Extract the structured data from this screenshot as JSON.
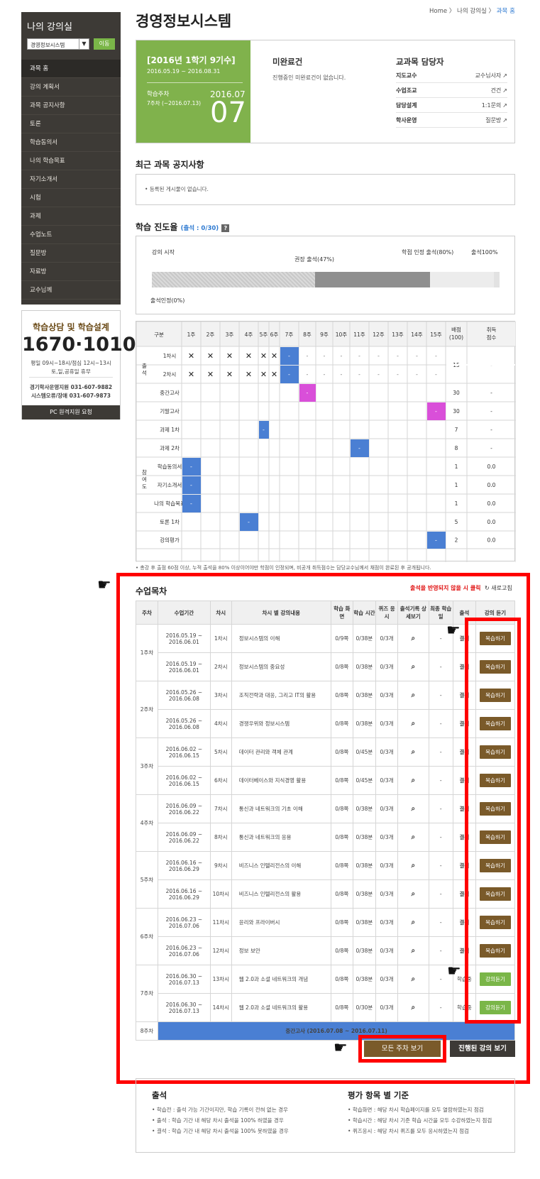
{
  "sidebar": {
    "title": "나의 강의실",
    "course_select": "경영정보시스템",
    "go_label": "이동",
    "menu": [
      "과목 홈",
      "강의 계획서",
      "과목 공지사항",
      "토론",
      "학습동의서",
      "나의 학습목표",
      "자기소개서",
      "시험",
      "과제",
      "수업노트",
      "질문방",
      "자료방",
      "교수님께"
    ],
    "help": {
      "title": "학습상담 및 학습설계",
      "phone": "1670·1010",
      "hours1": "평일 09시~18시/점심 12시~13시",
      "hours2": "토,일,공휴일 휴무",
      "contact1": "경기학사운영지원 031-607-9882",
      "contact2": "시스템오류/장애 031-607-9873",
      "remote": "PC 원격지원 요청"
    }
  },
  "header": {
    "title": "경영정보시스템",
    "breadcrumb": [
      "Home",
      "나의 강의실",
      "과목 홈"
    ]
  },
  "term": {
    "label": "[2016년 1학기 9기수]",
    "dates": "2016.05.19 ~ 2016.08.31",
    "week_label": "학습주차",
    "week_sub": "7주차 (~2016.07.13)",
    "month": "2016.07",
    "day": "07"
  },
  "unfinished": {
    "title": "미완료건",
    "text": "진행중인 미완료건이 없습니다."
  },
  "staff": {
    "title": "교과목 담당자",
    "rows": [
      {
        "k": "지도교수",
        "v": "교수님사자"
      },
      {
        "k": "수업조교",
        "v": "건건"
      },
      {
        "k": "담당설계",
        "v": "1:1문의"
      },
      {
        "k": "학사운영",
        "v": "질문방"
      }
    ]
  },
  "notice": {
    "title": "최근 과목 공지사항",
    "empty": "등록된 게시물이 없습니다."
  },
  "progress": {
    "title": "학습 진도율",
    "count": "(출석 : 0/30)",
    "help": "?",
    "labels": {
      "start": "강의 시작",
      "recommended": "권장 출석(47%)",
      "credit": "학점 인정 출석(80%)",
      "full": "출석100%",
      "current": "출석인정(0%)"
    },
    "values": {
      "current": 0,
      "recommended": 0.47,
      "credit": 0.8,
      "full": 1.0
    }
  },
  "attendance": {
    "headers": [
      "구분",
      "1주",
      "2주",
      "3주",
      "4주",
      "5주",
      "6주",
      "7주",
      "8주",
      "9주",
      "10주",
      "11주",
      "12주",
      "13주",
      "14주",
      "15주",
      "배점 (100)",
      "취득 점수"
    ],
    "group_att": "출석",
    "group_part": "참여도",
    "rows": [
      {
        "label": "1차시",
        "cells": [
          "x",
          "x",
          "x",
          "x",
          "x",
          "x",
          "b",
          "-",
          "-",
          "-",
          "-",
          "-",
          "-",
          "-",
          "-"
        ],
        "score": "15",
        "got": "-"
      },
      {
        "label": "2차시",
        "cells": [
          "x",
          "x",
          "x",
          "x",
          "x",
          "x",
          "b",
          "-",
          "-",
          "-",
          "-",
          "-",
          "-",
          "-",
          "-"
        ],
        "score": "",
        "got": ""
      },
      {
        "label": "중간고사",
        "cells": [
          "",
          "",
          "",
          "",
          "",
          "",
          "",
          "p",
          "",
          "",
          "",
          "",
          "",
          "",
          ""
        ],
        "score": "30",
        "got": "-"
      },
      {
        "label": "기말고사",
        "cells": [
          "",
          "",
          "",
          "",
          "",
          "",
          "",
          "",
          "",
          "",
          "",
          "",
          "",
          "",
          "p"
        ],
        "score": "30",
        "got": "-"
      },
      {
        "label": "과제 1차",
        "cells": [
          "",
          "",
          "",
          "",
          "b",
          "",
          "",
          "",
          "",
          "",
          "",
          "",
          "",
          "",
          ""
        ],
        "score": "7",
        "got": "-"
      },
      {
        "label": "과제 2차",
        "cells": [
          "",
          "",
          "",
          "",
          "",
          "",
          "",
          "",
          "",
          "",
          "b",
          "",
          "",
          "",
          ""
        ],
        "score": "8",
        "got": "-"
      },
      {
        "label": "학습동의서",
        "cells": [
          "b",
          "",
          "",
          "",
          "",
          "",
          "",
          "",
          "",
          "",
          "",
          "",
          "",
          "",
          ""
        ],
        "score": "1",
        "got": "0.0"
      },
      {
        "label": "자기소개서",
        "cells": [
          "b",
          "",
          "",
          "",
          "",
          "",
          "",
          "",
          "",
          "",
          "",
          "",
          "",
          "",
          ""
        ],
        "score": "1",
        "got": "0.0"
      },
      {
        "label": "나의 학습목표",
        "cells": [
          "b",
          "",
          "",
          "",
          "",
          "",
          "",
          "",
          "",
          "",
          "",
          "",
          "",
          "",
          ""
        ],
        "score": "1",
        "got": "0.0"
      },
      {
        "label": "토론 1차",
        "cells": [
          "",
          "",
          "",
          "b",
          "",
          "",
          "",
          "",
          "",
          "",
          "",
          "",
          "",
          "",
          ""
        ],
        "score": "5",
        "got": "0.0"
      },
      {
        "label": "강의평가",
        "cells": [
          "",
          "",
          "",
          "",
          "",
          "",
          "",
          "",
          "",
          "",
          "",
          "",
          "",
          "",
          "b"
        ],
        "score": "2",
        "got": "0.0"
      }
    ],
    "note": "• 총강 후 출점 60점 이상, 누적 출석을 80% 이상이어야만 학점이 인정되며, 비공개 취득점수는 담당교수님께서 채점이 완료된 후 공개됩니다."
  },
  "schedule": {
    "title": "수업목차",
    "alert": "출석을 반영되지 않을 시 클릭",
    "refresh": "새로고침",
    "headers": [
      "주차",
      "수업기간",
      "차시",
      "차시 별 강의내용",
      "학습 화면",
      "학습 시간",
      "퀴즈 응시",
      "출석기록 상세보기",
      "최종 학습일",
      "출석",
      "강의 듣기"
    ],
    "rows": [
      {
        "week": "1주차",
        "period": "2016.05.19 ~ 2016.06.01",
        "session": "1차시",
        "content": "정보시스템의 이해",
        "screen": "0/9쪽",
        "time": "0/38분",
        "quiz": "0/3개",
        "last": "-",
        "att": "결석",
        "btn": "복습하기",
        "type": "review"
      },
      {
        "week": "",
        "period": "2016.05.19 ~ 2016.06.01",
        "session": "2차시",
        "content": "정보시스템의 중요성",
        "screen": "0/8쪽",
        "time": "0/38분",
        "quiz": "0/3개",
        "last": "-",
        "att": "결석",
        "btn": "복습하기",
        "type": "review"
      },
      {
        "week": "2주차",
        "period": "2016.05.26 ~ 2016.06.08",
        "session": "3차시",
        "content": "조직전략과 대응, 그리고 IT의 활용",
        "screen": "0/8쪽",
        "time": "0/38분",
        "quiz": "0/3개",
        "last": "-",
        "att": "결석",
        "btn": "복습하기",
        "type": "review"
      },
      {
        "week": "",
        "period": "2016.05.26 ~ 2016.06.08",
        "session": "4차시",
        "content": "경쟁우위와 정보시스템",
        "screen": "0/8쪽",
        "time": "0/38분",
        "quiz": "0/3개",
        "last": "-",
        "att": "결석",
        "btn": "복습하기",
        "type": "review"
      },
      {
        "week": "3주차",
        "period": "2016.06.02 ~ 2016.06.15",
        "session": "5차시",
        "content": "데이터 관리와 객체 관계",
        "screen": "0/8쪽",
        "time": "0/45분",
        "quiz": "0/3개",
        "last": "-",
        "att": "결석",
        "btn": "복습하기",
        "type": "review"
      },
      {
        "week": "",
        "period": "2016.06.02 ~ 2016.06.15",
        "session": "6차시",
        "content": "데이터베이스와 지식경영 활용",
        "screen": "0/8쪽",
        "time": "0/45분",
        "quiz": "0/3개",
        "last": "-",
        "att": "결석",
        "btn": "복습하기",
        "type": "review"
      },
      {
        "week": "4주차",
        "period": "2016.06.09 ~ 2016.06.22",
        "session": "7차시",
        "content": "통신과 네트워크의 기초 이해",
        "screen": "0/8쪽",
        "time": "0/38분",
        "quiz": "0/3개",
        "last": "-",
        "att": "결석",
        "btn": "복습하기",
        "type": "review"
      },
      {
        "week": "",
        "period": "2016.06.09 ~ 2016.06.22",
        "session": "8차시",
        "content": "통신과 네트워크의 응용",
        "screen": "0/8쪽",
        "time": "0/38분",
        "quiz": "0/3개",
        "last": "-",
        "att": "결석",
        "btn": "복습하기",
        "type": "review"
      },
      {
        "week": "5주차",
        "period": "2016.06.16 ~ 2016.06.29",
        "session": "9차시",
        "content": "비즈니스 인텔리전스의 이해",
        "screen": "0/8쪽",
        "time": "0/38분",
        "quiz": "0/3개",
        "last": "-",
        "att": "결석",
        "btn": "복습하기",
        "type": "review"
      },
      {
        "week": "",
        "period": "2016.06.16 ~ 2016.06.29",
        "session": "10차시",
        "content": "비즈니스 인텔리전스의 활용",
        "screen": "0/8쪽",
        "time": "0/38분",
        "quiz": "0/3개",
        "last": "-",
        "att": "결석",
        "btn": "복습하기",
        "type": "review"
      },
      {
        "week": "6주차",
        "period": "2016.06.23 ~ 2016.07.06",
        "session": "11차시",
        "content": "윤리와 프라이버시",
        "screen": "0/8쪽",
        "time": "0/38분",
        "quiz": "0/3개",
        "last": "-",
        "att": "결석",
        "btn": "복습하기",
        "type": "review"
      },
      {
        "week": "",
        "period": "2016.06.23 ~ 2016.07.06",
        "session": "12차시",
        "content": "정보 보안",
        "screen": "0/8쪽",
        "time": "0/38분",
        "quiz": "0/3개",
        "last": "-",
        "att": "결석",
        "btn": "복습하기",
        "type": "review"
      },
      {
        "week": "7주차",
        "period": "2016.06.30 ~ 2016.07.13",
        "session": "13차시",
        "content": "웹 2.0과 소셜 네트워크의 개념",
        "screen": "0/8쪽",
        "time": "0/38분",
        "quiz": "0/3개",
        "last": "-",
        "att": "학습중",
        "btn": "강의듣기",
        "type": "lecture"
      },
      {
        "week": "",
        "period": "2016.06.30 ~ 2016.07.13",
        "session": "14차시",
        "content": "웹 2.0과 소셜 네트워크의 활용",
        "screen": "0/8쪽",
        "time": "0/30분",
        "quiz": "0/3개",
        "last": "-",
        "att": "학습중",
        "btn": "강의듣기",
        "type": "lecture"
      }
    ],
    "midterm_week": "8주차",
    "midterm": "중간고사 (2016.07.08 ~ 2016.07.11)",
    "btn_all": "모든 주차 보기",
    "btn_progress": "진행된 강의 보기"
  },
  "criteria": {
    "att_title": "출석",
    "att_items": [
      "학습전 : 출석 가능 기간이지만, 학습 기록이 전혀 없는 경우",
      "출석 : 학습 기간 내 해당 차시 출석을 100% 하였을 경우",
      "결석 : 학습 기간 내 해당 차시 출석을 100% 못하였을 경우"
    ],
    "eval_title": "평가 항목 별 기준",
    "eval_items": [
      "학습화면 : 해당 차시 학습페이지를 모두 열람하였는지 점검",
      "학습시간 : 해당 차시 기준 학습 시간을 모두 수강하였는지 점검",
      "퀴즈응시 : 해당 차시 퀴즈를 모두 응시하였는지 점검"
    ]
  },
  "colors": {
    "brand_dark": "#3d3a36",
    "green": "#80b24c",
    "brown": "#7a5a2a",
    "blue": "#4a7fd3",
    "magenta": "#d94fd9",
    "red_outline": "#ff0000"
  }
}
